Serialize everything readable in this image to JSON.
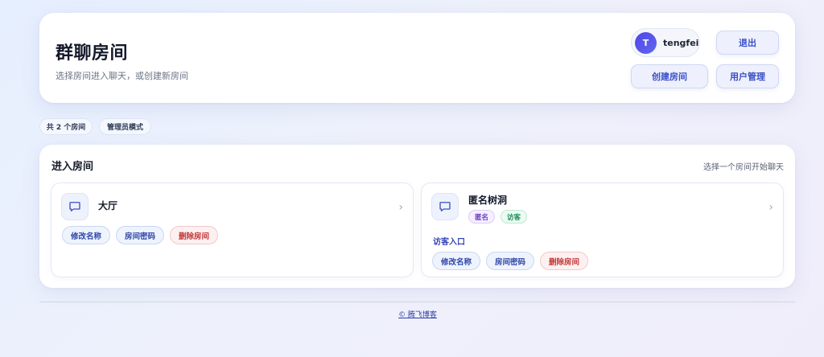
{
  "header": {
    "title": "群聊房间",
    "subtitle": "选择房间进入聊天，或创建新房间",
    "user": {
      "avatar_letter": "T",
      "name": "tengfei"
    },
    "logout_label": "退出",
    "create_room_label": "创建房间",
    "user_admin_label": "用户管理"
  },
  "chips": {
    "room_count": "共 2 个房间",
    "admin_mode": "管理员模式"
  },
  "section": {
    "title": "进入房间",
    "hint": "选择一个房间开始聊天"
  },
  "rooms": [
    {
      "name": "大厅",
      "tags": [],
      "actions": {
        "rename": "修改名称",
        "password": "房间密码",
        "delete": "删除房间"
      }
    },
    {
      "name": "匿名树洞",
      "tags": [
        "匿名",
        "访客"
      ],
      "guest_entry": "访客入口",
      "actions": {
        "rename": "修改名称",
        "password": "房间密码",
        "delete": "删除房间"
      }
    }
  ],
  "footer": {
    "link": "© 腾飞博客"
  },
  "icons": {
    "room": "chat-bubble-icon",
    "chevron": "chevron-right-icon"
  },
  "colors": {
    "accent": "#3b4fc6",
    "danger": "#c23737",
    "anon_tag": "#6b3fc1",
    "guest_tag": "#1e8a55"
  }
}
